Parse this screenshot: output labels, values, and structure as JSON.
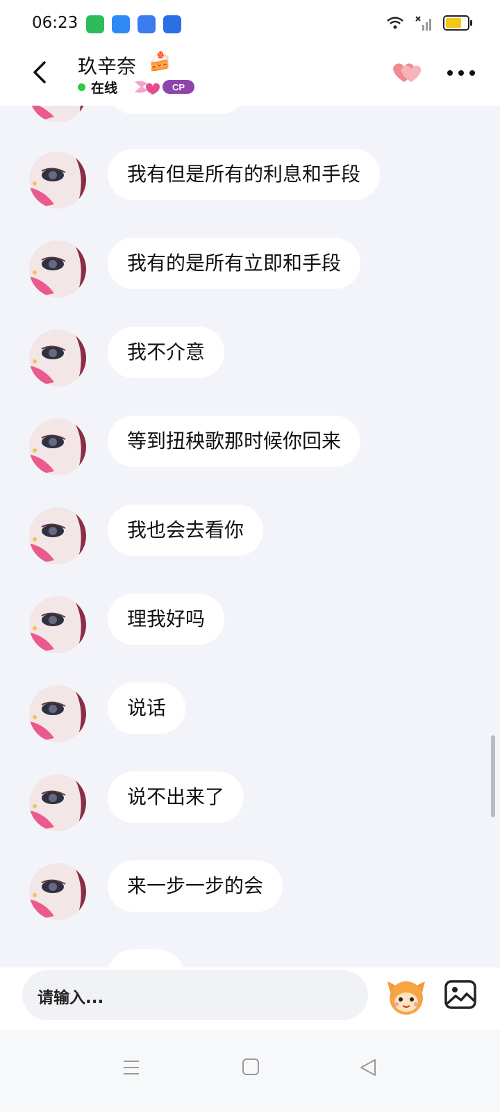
{
  "status_bar": {
    "time": "06:23",
    "app_icons": [
      "green-app-icon",
      "blue-feather-icon",
      "blue-chat-icon",
      "blue-window-icon"
    ],
    "battery_color": "#f5c518"
  },
  "header": {
    "contact_name": "玖辛奈",
    "name_emoji": "🍰",
    "status_text": "在线",
    "status_color": "#2ecc40",
    "badge_text": "CP",
    "badge_color": "#8e44ad"
  },
  "messages": [
    {
      "text": "我有但是所有的利息和手段"
    },
    {
      "text": "我有的是所有立即和手段"
    },
    {
      "text": "我不介意"
    },
    {
      "text": "等到扭秧歌那时候你回来"
    },
    {
      "text": "我也会去看你"
    },
    {
      "text": "理我好吗"
    },
    {
      "text": "说话"
    },
    {
      "text": "说不出来了"
    },
    {
      "text": "来一步一步的会"
    }
  ],
  "input": {
    "placeholder": "请输入..."
  },
  "colors": {
    "background": "#f2f4fa",
    "bubble": "#ffffff",
    "heart": "#f08a93"
  }
}
